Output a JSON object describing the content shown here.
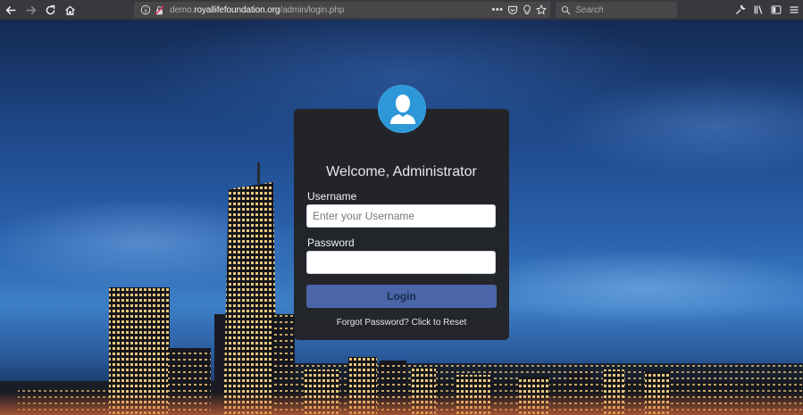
{
  "browser": {
    "url_prefix": "demo.",
    "url_domain": "royallifefoundation.org",
    "url_path": "/admin/login.php",
    "page_actions": "•••",
    "search_placeholder": "Search"
  },
  "login": {
    "title": "Welcome, Administrator",
    "username_label": "Username",
    "username_placeholder": "Enter your Username",
    "username_value": "",
    "password_label": "Password",
    "password_value": "",
    "submit_label": "Login",
    "forgot_text": "Forgot Password? Click to Reset"
  },
  "colors": {
    "card_bg": "#222224",
    "avatar_bg": "#2e97d8",
    "button_bg": "#4a66a8",
    "toolbar_bg": "#38383d"
  },
  "icons": [
    "back-arrow-icon",
    "forward-arrow-icon",
    "reload-icon",
    "home-icon",
    "info-icon",
    "insecure-lock-icon",
    "pocket-icon",
    "lightbulb-icon",
    "bookmark-star-icon",
    "search-icon",
    "wrench-icon",
    "library-icon",
    "sidebar-icon",
    "user-silhouette-icon"
  ]
}
